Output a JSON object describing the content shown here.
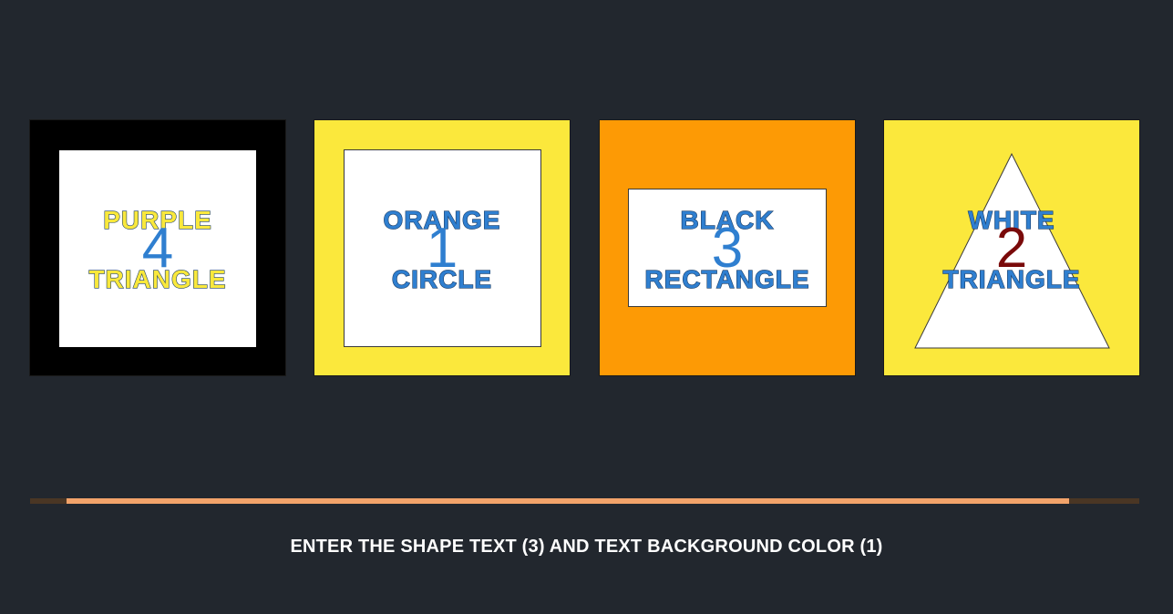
{
  "cards": [
    {
      "background_color": "#000000",
      "shape": "square",
      "shape_color": "#ffffff",
      "number": "4",
      "number_color": "#2f7fd0",
      "line1": "PURPLE",
      "line2": "TRIANGLE",
      "text_color": "#f9e83c",
      "text_outline": "#1b3d66"
    },
    {
      "background_color": "#fbe83c",
      "shape": "square",
      "shape_color": "#ffffff",
      "number": "1",
      "number_color": "#2f7fd0",
      "line1": "ORANGE",
      "line2": "CIRCLE",
      "text_color": "#2f7fd0",
      "text_outline": "#1b3d66"
    },
    {
      "background_color": "#fd9a05",
      "shape": "rectangle",
      "shape_color": "#ffffff",
      "number": "3",
      "number_color": "#2f7fd0",
      "line1": "BLACK",
      "line2": "RECTANGLE",
      "text_color": "#2f7fd0",
      "text_outline": "#1b3d66"
    },
    {
      "background_color": "#fbe83c",
      "shape": "triangle",
      "shape_color": "#ffffff",
      "number": "2",
      "number_color": "#7a0a0a",
      "line1": "WHITE",
      "line2": "TRIANGLE",
      "text_color": "#2f7fd0",
      "text_outline": "#1b3d66"
    }
  ],
  "progress": {
    "fraction": 0.935,
    "track_color": "#4a3624",
    "fill_color": "#f2a36a"
  },
  "instruction": "ENTER THE SHAPE TEXT (3) AND TEXT BACKGROUND COLOR (1)"
}
